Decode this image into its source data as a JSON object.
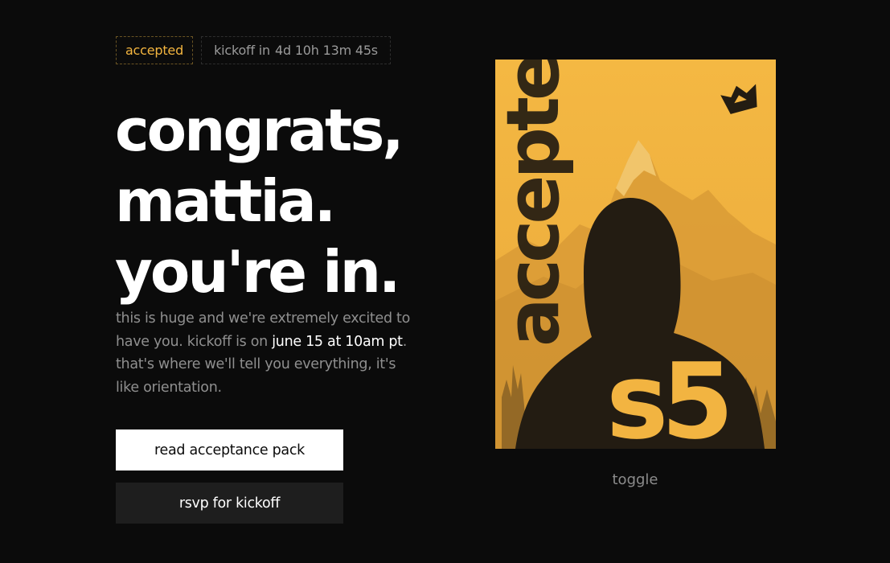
{
  "status_badge": "accepted",
  "countdown": {
    "label": "kickoff in",
    "time": "4d 10h 13m 45s"
  },
  "headline": {
    "line1": "congrats,",
    "line2": "mattia.",
    "line3": "you're in."
  },
  "message": {
    "part1": "this is huge and we're extremely excited to have you. kickoff is on ",
    "highlight": "june 15 at 10am pt",
    "part2": ". that's where we'll tell you everything, it's like orientation."
  },
  "buttons": {
    "primary": "read acceptance pack",
    "secondary": "rsvp for kickoff"
  },
  "poster": {
    "vertical_text": "accepted",
    "season": "s5",
    "accent_color": "#f2b441",
    "ink_color": "#231c12"
  },
  "toggle_label": "toggle",
  "icons": {
    "logo": "crown-logo-icon"
  }
}
